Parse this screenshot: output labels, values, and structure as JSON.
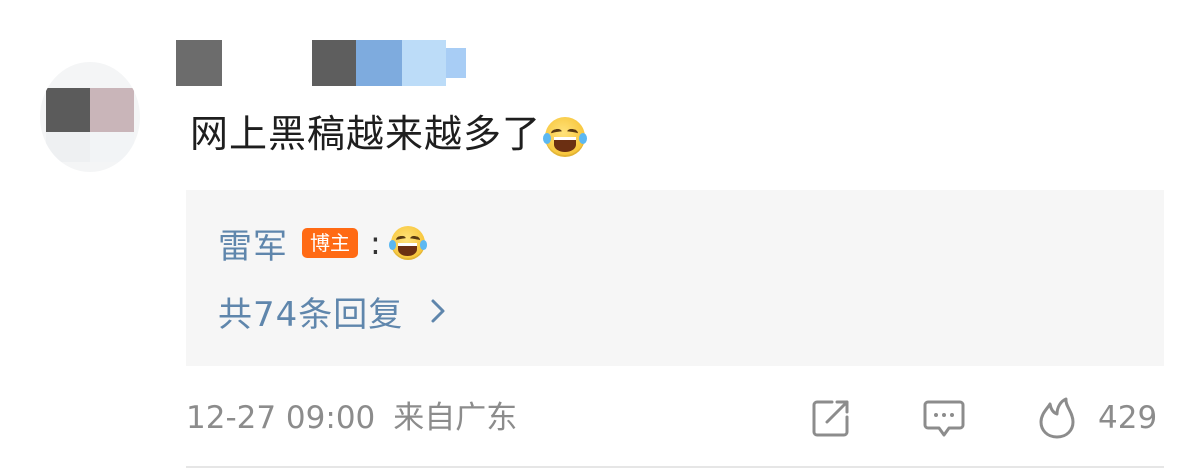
{
  "comment": {
    "text": "网上黑稿越来越多了",
    "emoji": "laughing-tears-emoji"
  },
  "reply_preview": {
    "author": "雷军",
    "badge": "博主",
    "separator": ":",
    "emoji": "laughing-tears-emoji",
    "more_replies": "共74条回复"
  },
  "meta": {
    "time": "12-27 09:00",
    "location": "来自广东"
  },
  "actions": {
    "share_icon": "share-icon",
    "reply_icon": "comment-icon",
    "like_icon": "fire-icon",
    "like_count": "429"
  },
  "colors": {
    "link": "#5f86ac",
    "badge_bg": "#ff6a14",
    "meta_text": "#8c8c8c",
    "reply_bg": "#f6f6f6"
  }
}
